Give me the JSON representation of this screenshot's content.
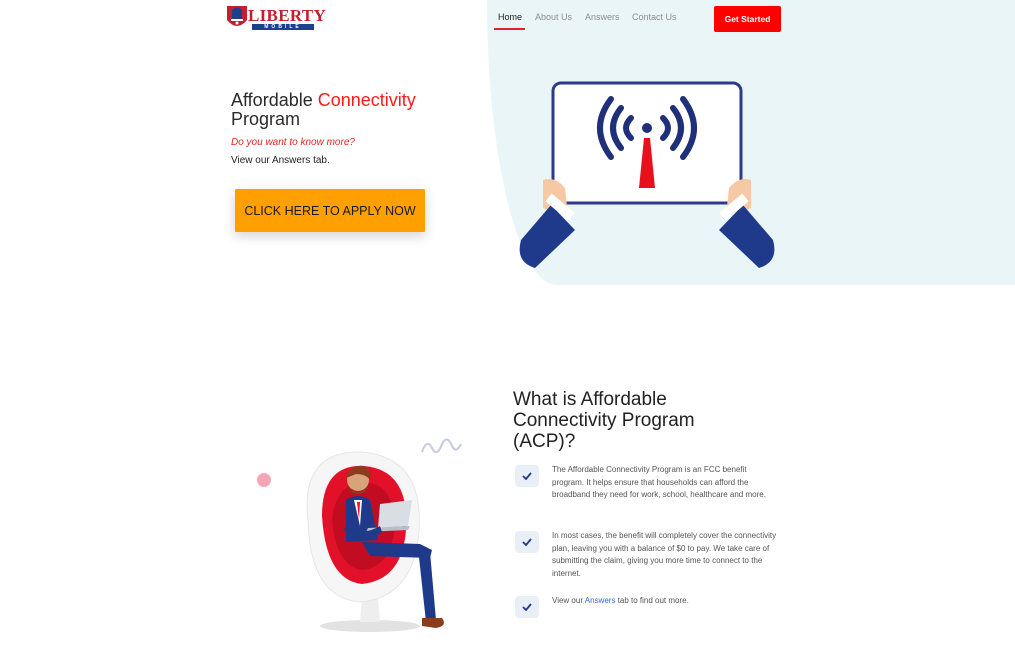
{
  "brand": {
    "name": "LIBERTY",
    "sub": "MOBILE"
  },
  "nav": {
    "items": [
      {
        "label": "Home"
      },
      {
        "label": "About Us"
      },
      {
        "label": "Answers"
      },
      {
        "label": "Contact Us"
      }
    ],
    "cta": "Get Started"
  },
  "hero": {
    "title_part1": "Affordable ",
    "title_highlight": "Connectivity",
    "title_part2": "Program",
    "question": "Do you want to know more?",
    "subtext": "View our Answers tab.",
    "apply_button": "CLICK HERE TO APPLY NOW"
  },
  "acp": {
    "title": "What is Affordable Connectivity Program (ACP)?",
    "feature1": "The Affordable Connectivity Program is an FCC benefit program. It helps ensure that households can afford the broadband they need for work, school, healthcare and more.",
    "feature2": "In most cases, the benefit will completely cover the connectivity plan, leaving you with a balance of $0 to pay. We take care of submitting the claim, giving you more time to connect to the internet.",
    "feature3_pre": "View our ",
    "feature3_link": "Answers",
    "feature3_post": " tab to find out more."
  },
  "colors": {
    "accent_red": "#ff0000",
    "apply_orange": "#ff9f00",
    "navy": "#1f3a7a"
  }
}
